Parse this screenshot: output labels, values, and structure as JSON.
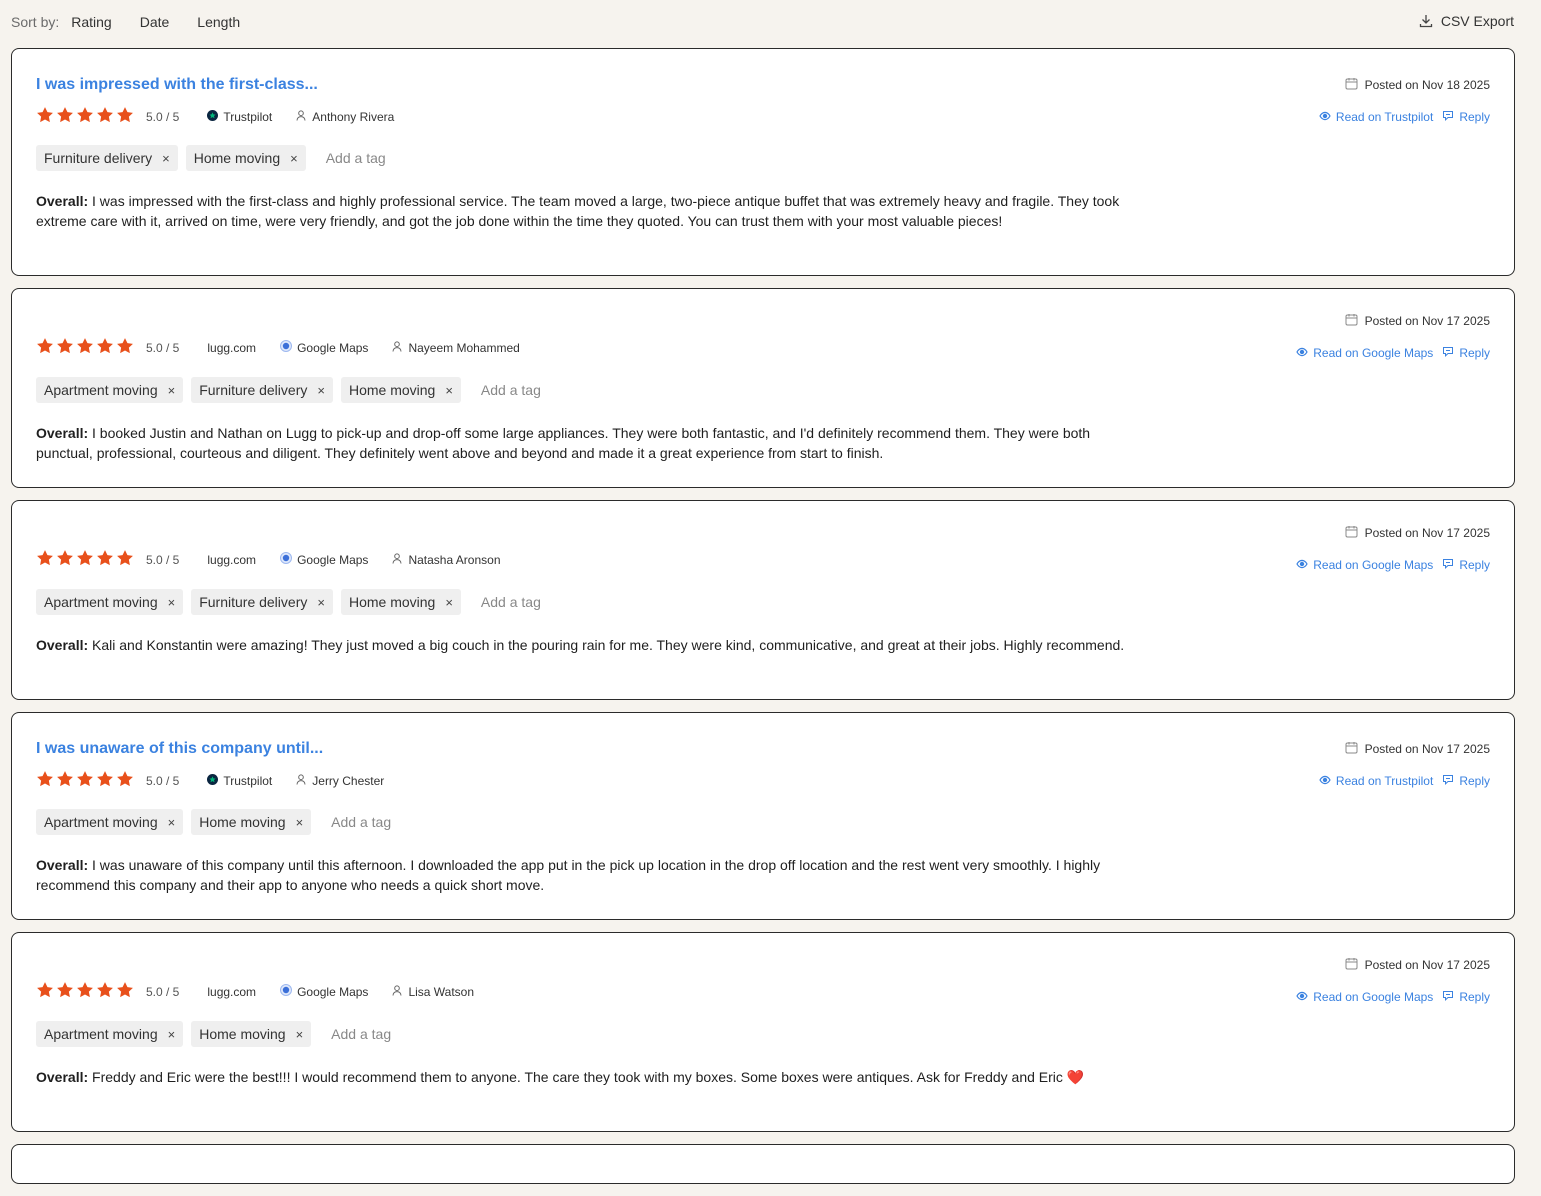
{
  "toolbar": {
    "sort_label": "Sort by:",
    "sort_options": [
      "Rating",
      "Date",
      "Length"
    ],
    "csv_export": "CSV Export"
  },
  "colors": {
    "accent": "#3b82e0",
    "star": "#e8501b"
  },
  "reviews": [
    {
      "title": "I was impressed with the first-class...",
      "rating_text": "5.0 / 5",
      "stars": 5,
      "domain": "",
      "source": "Trustpilot",
      "author": "Anthony Rivera",
      "tags": [
        "Furniture delivery",
        "Home moving"
      ],
      "add_tag": "Add a tag",
      "overall_label": "Overall:",
      "text": "I was impressed with the first-class and highly professional service. The team moved a large, two-piece antique buffet that was extremely heavy and fragile. They took extreme care with it, arrived on time, were very friendly, and got the job done within the time they quoted. You can trust them with your most valuable pieces!",
      "posted": "Posted on Nov 18 2025",
      "read_on": "Read on Trustpilot",
      "reply": "Reply"
    },
    {
      "title": "",
      "rating_text": "5.0 / 5",
      "stars": 5,
      "domain": "lugg.com",
      "source": "Google Maps",
      "author": "Nayeem Mohammed",
      "tags": [
        "Apartment moving",
        "Furniture delivery",
        "Home moving"
      ],
      "add_tag": "Add a tag",
      "overall_label": "Overall:",
      "text": "I booked Justin and Nathan on Lugg to pick-up and drop-off some large appliances. They were both fantastic, and I'd definitely recommend them. They were both punctual, professional, courteous and diligent. They definitely went above and beyond and made it a great experience from start to finish.",
      "posted": "Posted on Nov 17 2025",
      "read_on": "Read on Google Maps",
      "reply": "Reply"
    },
    {
      "title": "",
      "rating_text": "5.0 / 5",
      "stars": 5,
      "domain": "lugg.com",
      "source": "Google Maps",
      "author": "Natasha Aronson",
      "tags": [
        "Apartment moving",
        "Furniture delivery",
        "Home moving"
      ],
      "add_tag": "Add a tag",
      "overall_label": "Overall:",
      "text": "Kali and Konstantin were amazing! They just moved a big couch in the pouring rain for me. They were kind, communicative, and great at their jobs. Highly recommend.",
      "posted": "Posted on Nov 17 2025",
      "read_on": "Read on Google Maps",
      "reply": "Reply"
    },
    {
      "title": "I was unaware of this company until...",
      "rating_text": "5.0 / 5",
      "stars": 5,
      "domain": "",
      "source": "Trustpilot",
      "author": "Jerry Chester",
      "tags": [
        "Apartment moving",
        "Home moving"
      ],
      "add_tag": "Add a tag",
      "overall_label": "Overall:",
      "text": "I was unaware of this company until this afternoon. I downloaded the app put in the pick up location in the drop off location and the rest went very smoothly. I highly recommend this company and their app to anyone who needs a quick short move.",
      "posted": "Posted on Nov 17 2025",
      "read_on": "Read on Trustpilot",
      "reply": "Reply"
    },
    {
      "title": "",
      "rating_text": "5.0 / 5",
      "stars": 5,
      "domain": "lugg.com",
      "source": "Google Maps",
      "author": "Lisa Watson",
      "tags": [
        "Apartment moving",
        "Home moving"
      ],
      "add_tag": "Add a tag",
      "overall_label": "Overall:",
      "text": "Freddy and Eric were the best!!! I would recommend them to anyone. The care they took with my boxes. Some boxes were antiques. Ask for Freddy and Eric ❤️",
      "posted": "Posted on Nov 17 2025",
      "read_on": "Read on Google Maps",
      "reply": "Reply"
    }
  ]
}
